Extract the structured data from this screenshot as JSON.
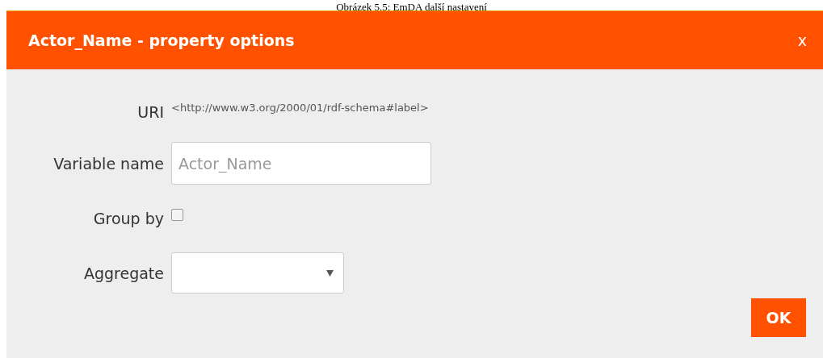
{
  "caption": "Obrázek 5.5: EmDA další nastavení",
  "dialog": {
    "title": "Actor_Name - property options",
    "close": "x",
    "fields": [
      {
        "kind": "text",
        "label": "URI",
        "value": "<http://www.w3.org/2000/01/rdf-schema#label>"
      },
      {
        "kind": "input",
        "label": "Variable name",
        "placeholder": "Actor_Name"
      },
      {
        "kind": "checkbox",
        "label": "Group by",
        "checked": false
      },
      {
        "kind": "select",
        "label": "Aggregate"
      }
    ],
    "ok": "OK"
  }
}
